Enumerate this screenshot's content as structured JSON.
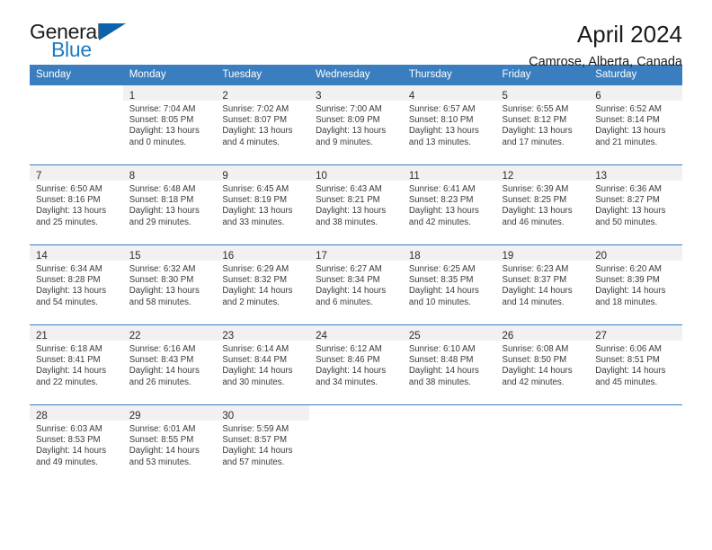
{
  "brand": {
    "name_part1": "General",
    "name_part2": "Blue"
  },
  "header": {
    "title": "April 2024",
    "subtitle": "Camrose, Alberta, Canada"
  },
  "colors": {
    "header_blue": "#3a7ebf",
    "logo_blue": "#1f7ac4",
    "daynum_band": "#f1f1f1"
  },
  "weekday_headers": [
    "Sunday",
    "Monday",
    "Tuesday",
    "Wednesday",
    "Thursday",
    "Friday",
    "Saturday"
  ],
  "weeks": [
    [
      {
        "day": "",
        "sunrise": "",
        "sunset": "",
        "daylight1": "",
        "daylight2": "",
        "empty": true
      },
      {
        "day": "1",
        "sunrise": "Sunrise: 7:04 AM",
        "sunset": "Sunset: 8:05 PM",
        "daylight1": "Daylight: 13 hours",
        "daylight2": "and 0 minutes."
      },
      {
        "day": "2",
        "sunrise": "Sunrise: 7:02 AM",
        "sunset": "Sunset: 8:07 PM",
        "daylight1": "Daylight: 13 hours",
        "daylight2": "and 4 minutes."
      },
      {
        "day": "3",
        "sunrise": "Sunrise: 7:00 AM",
        "sunset": "Sunset: 8:09 PM",
        "daylight1": "Daylight: 13 hours",
        "daylight2": "and 9 minutes."
      },
      {
        "day": "4",
        "sunrise": "Sunrise: 6:57 AM",
        "sunset": "Sunset: 8:10 PM",
        "daylight1": "Daylight: 13 hours",
        "daylight2": "and 13 minutes."
      },
      {
        "day": "5",
        "sunrise": "Sunrise: 6:55 AM",
        "sunset": "Sunset: 8:12 PM",
        "daylight1": "Daylight: 13 hours",
        "daylight2": "and 17 minutes."
      },
      {
        "day": "6",
        "sunrise": "Sunrise: 6:52 AM",
        "sunset": "Sunset: 8:14 PM",
        "daylight1": "Daylight: 13 hours",
        "daylight2": "and 21 minutes."
      }
    ],
    [
      {
        "day": "7",
        "sunrise": "Sunrise: 6:50 AM",
        "sunset": "Sunset: 8:16 PM",
        "daylight1": "Daylight: 13 hours",
        "daylight2": "and 25 minutes."
      },
      {
        "day": "8",
        "sunrise": "Sunrise: 6:48 AM",
        "sunset": "Sunset: 8:18 PM",
        "daylight1": "Daylight: 13 hours",
        "daylight2": "and 29 minutes."
      },
      {
        "day": "9",
        "sunrise": "Sunrise: 6:45 AM",
        "sunset": "Sunset: 8:19 PM",
        "daylight1": "Daylight: 13 hours",
        "daylight2": "and 33 minutes."
      },
      {
        "day": "10",
        "sunrise": "Sunrise: 6:43 AM",
        "sunset": "Sunset: 8:21 PM",
        "daylight1": "Daylight: 13 hours",
        "daylight2": "and 38 minutes."
      },
      {
        "day": "11",
        "sunrise": "Sunrise: 6:41 AM",
        "sunset": "Sunset: 8:23 PM",
        "daylight1": "Daylight: 13 hours",
        "daylight2": "and 42 minutes."
      },
      {
        "day": "12",
        "sunrise": "Sunrise: 6:39 AM",
        "sunset": "Sunset: 8:25 PM",
        "daylight1": "Daylight: 13 hours",
        "daylight2": "and 46 minutes."
      },
      {
        "day": "13",
        "sunrise": "Sunrise: 6:36 AM",
        "sunset": "Sunset: 8:27 PM",
        "daylight1": "Daylight: 13 hours",
        "daylight2": "and 50 minutes."
      }
    ],
    [
      {
        "day": "14",
        "sunrise": "Sunrise: 6:34 AM",
        "sunset": "Sunset: 8:28 PM",
        "daylight1": "Daylight: 13 hours",
        "daylight2": "and 54 minutes."
      },
      {
        "day": "15",
        "sunrise": "Sunrise: 6:32 AM",
        "sunset": "Sunset: 8:30 PM",
        "daylight1": "Daylight: 13 hours",
        "daylight2": "and 58 minutes."
      },
      {
        "day": "16",
        "sunrise": "Sunrise: 6:29 AM",
        "sunset": "Sunset: 8:32 PM",
        "daylight1": "Daylight: 14 hours",
        "daylight2": "and 2 minutes."
      },
      {
        "day": "17",
        "sunrise": "Sunrise: 6:27 AM",
        "sunset": "Sunset: 8:34 PM",
        "daylight1": "Daylight: 14 hours",
        "daylight2": "and 6 minutes."
      },
      {
        "day": "18",
        "sunrise": "Sunrise: 6:25 AM",
        "sunset": "Sunset: 8:35 PM",
        "daylight1": "Daylight: 14 hours",
        "daylight2": "and 10 minutes."
      },
      {
        "day": "19",
        "sunrise": "Sunrise: 6:23 AM",
        "sunset": "Sunset: 8:37 PM",
        "daylight1": "Daylight: 14 hours",
        "daylight2": "and 14 minutes."
      },
      {
        "day": "20",
        "sunrise": "Sunrise: 6:20 AM",
        "sunset": "Sunset: 8:39 PM",
        "daylight1": "Daylight: 14 hours",
        "daylight2": "and 18 minutes."
      }
    ],
    [
      {
        "day": "21",
        "sunrise": "Sunrise: 6:18 AM",
        "sunset": "Sunset: 8:41 PM",
        "daylight1": "Daylight: 14 hours",
        "daylight2": "and 22 minutes."
      },
      {
        "day": "22",
        "sunrise": "Sunrise: 6:16 AM",
        "sunset": "Sunset: 8:43 PM",
        "daylight1": "Daylight: 14 hours",
        "daylight2": "and 26 minutes."
      },
      {
        "day": "23",
        "sunrise": "Sunrise: 6:14 AM",
        "sunset": "Sunset: 8:44 PM",
        "daylight1": "Daylight: 14 hours",
        "daylight2": "and 30 minutes."
      },
      {
        "day": "24",
        "sunrise": "Sunrise: 6:12 AM",
        "sunset": "Sunset: 8:46 PM",
        "daylight1": "Daylight: 14 hours",
        "daylight2": "and 34 minutes."
      },
      {
        "day": "25",
        "sunrise": "Sunrise: 6:10 AM",
        "sunset": "Sunset: 8:48 PM",
        "daylight1": "Daylight: 14 hours",
        "daylight2": "and 38 minutes."
      },
      {
        "day": "26",
        "sunrise": "Sunrise: 6:08 AM",
        "sunset": "Sunset: 8:50 PM",
        "daylight1": "Daylight: 14 hours",
        "daylight2": "and 42 minutes."
      },
      {
        "day": "27",
        "sunrise": "Sunrise: 6:06 AM",
        "sunset": "Sunset: 8:51 PM",
        "daylight1": "Daylight: 14 hours",
        "daylight2": "and 45 minutes."
      }
    ],
    [
      {
        "day": "28",
        "sunrise": "Sunrise: 6:03 AM",
        "sunset": "Sunset: 8:53 PM",
        "daylight1": "Daylight: 14 hours",
        "daylight2": "and 49 minutes."
      },
      {
        "day": "29",
        "sunrise": "Sunrise: 6:01 AM",
        "sunset": "Sunset: 8:55 PM",
        "daylight1": "Daylight: 14 hours",
        "daylight2": "and 53 minutes."
      },
      {
        "day": "30",
        "sunrise": "Sunrise: 5:59 AM",
        "sunset": "Sunset: 8:57 PM",
        "daylight1": "Daylight: 14 hours",
        "daylight2": "and 57 minutes."
      },
      {
        "day": "",
        "sunrise": "",
        "sunset": "",
        "daylight1": "",
        "daylight2": "",
        "empty": true
      },
      {
        "day": "",
        "sunrise": "",
        "sunset": "",
        "daylight1": "",
        "daylight2": "",
        "empty": true
      },
      {
        "day": "",
        "sunrise": "",
        "sunset": "",
        "daylight1": "",
        "daylight2": "",
        "empty": true
      },
      {
        "day": "",
        "sunrise": "",
        "sunset": "",
        "daylight1": "",
        "daylight2": "",
        "empty": true
      }
    ]
  ]
}
